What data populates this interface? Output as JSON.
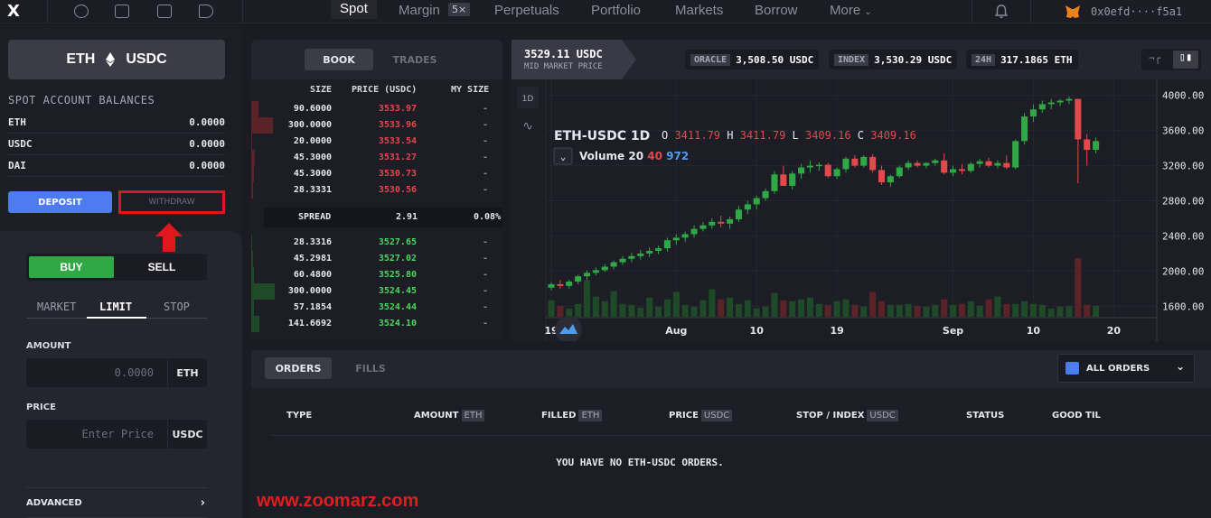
{
  "nav": {
    "logo": "X",
    "menu": [
      "Spot",
      "Margin",
      "Perpetuals",
      "Portfolio",
      "Markets",
      "Borrow",
      "More"
    ],
    "margin_badge": "5×",
    "address": "0x0efd····f5a1"
  },
  "left": {
    "pair": {
      "base": "ETH",
      "quote": "USDC"
    },
    "balances_title": "SPOT ACCOUNT BALANCES",
    "balances": [
      {
        "asset": "ETH",
        "amount": "0.0000"
      },
      {
        "asset": "USDC",
        "amount": "0.0000"
      },
      {
        "asset": "DAI",
        "amount": "0.0000"
      }
    ],
    "deposit_label": "DEPOSIT",
    "withdraw_label": "WITHDRAW",
    "buy_label": "BUY",
    "sell_label": "SELL",
    "order_tabs": [
      "MARKET",
      "LIMIT",
      "STOP"
    ],
    "amount_label": "AMOUNT",
    "amount_value": "0.0000",
    "amount_unit": "ETH",
    "price_label": "PRICE",
    "price_placeholder": "Enter Price",
    "price_unit": "USDC",
    "advanced_label": "ADVANCED"
  },
  "book": {
    "tabs": [
      "BOOK",
      "TRADES"
    ],
    "headers": {
      "size": "SIZE",
      "price": "PRICE (USDC)",
      "my": "MY SIZE"
    },
    "asks": [
      {
        "size": "90.6000",
        "price": "3533.97",
        "my": "-",
        "depth": 0.27
      },
      {
        "size": "300.0000",
        "price": "3533.96",
        "my": "-",
        "depth": 0.8
      },
      {
        "size": "20.0000",
        "price": "3533.54",
        "my": "-",
        "depth": 0.02
      },
      {
        "size": "45.3000",
        "price": "3531.27",
        "my": "-",
        "depth": 0.12
      },
      {
        "size": "45.3000",
        "price": "3530.73",
        "my": "-",
        "depth": 0.09
      },
      {
        "size": "28.3331",
        "price": "3530.56",
        "my": "-",
        "depth": 0.06
      }
    ],
    "spread": {
      "label": "SPREAD",
      "value": "2.91",
      "pct": "0.08%"
    },
    "bids": [
      {
        "size": "28.3316",
        "price": "3527.65",
        "my": "-",
        "depth": 0.04
      },
      {
        "size": "45.2981",
        "price": "3527.02",
        "my": "-",
        "depth": 0.06
      },
      {
        "size": "60.4800",
        "price": "3525.80",
        "my": "-",
        "depth": 0.1
      },
      {
        "size": "300.0000",
        "price": "3524.45",
        "my": "-",
        "depth": 0.85
      },
      {
        "size": "57.1854",
        "price": "3524.44",
        "my": "-",
        "depth": 0.1
      },
      {
        "size": "141.6692",
        "price": "3524.10",
        "my": "-",
        "depth": 0.3
      }
    ]
  },
  "chart_header": {
    "mid_price": "3529.11 USDC",
    "mid_label": "MID MARKET PRICE",
    "oracle_label": "ORACLE",
    "oracle_value": "3,508.50 USDC",
    "index_label": "INDEX",
    "index_value": "3,530.29 USDC",
    "vol_label": "24H",
    "vol_value": "317.1865 ETH"
  },
  "chart_data": {
    "type": "candlestick",
    "symbol": "ETH-USDC",
    "interval": "1D",
    "ohlc_labels": {
      "o": "3411.79",
      "h": "3411.79",
      "l": "3409.16",
      "c": "3409.16"
    },
    "volume_label": "Volume 20",
    "volume_vals": [
      "40",
      "972"
    ],
    "y_ticks": [
      4000,
      3600,
      3200,
      2800,
      2400,
      2000,
      1600
    ],
    "ylim": [
      1500,
      4100
    ],
    "x_ticks": [
      "19",
      "Aug",
      "10",
      "19",
      "Sep",
      "10",
      "20"
    ],
    "candles": [
      [
        1810,
        1870,
        1780,
        1850
      ],
      [
        1850,
        1900,
        1800,
        1830
      ],
      [
        1830,
        1900,
        1800,
        1880
      ],
      [
        1880,
        1960,
        1850,
        1940
      ],
      [
        1940,
        2010,
        1900,
        1980
      ],
      [
        1980,
        2040,
        1950,
        2010
      ],
      [
        2010,
        2080,
        1990,
        2050
      ],
      [
        2050,
        2120,
        2020,
        2100
      ],
      [
        2100,
        2170,
        2070,
        2140
      ],
      [
        2140,
        2210,
        2100,
        2170
      ],
      [
        2170,
        2240,
        2130,
        2200
      ],
      [
        2200,
        2270,
        2160,
        2230
      ],
      [
        2230,
        2290,
        2190,
        2260
      ],
      [
        2260,
        2380,
        2220,
        2350
      ],
      [
        2350,
        2420,
        2300,
        2380
      ],
      [
        2380,
        2450,
        2330,
        2420
      ],
      [
        2420,
        2520,
        2380,
        2480
      ],
      [
        2480,
        2560,
        2450,
        2520
      ],
      [
        2520,
        2600,
        2480,
        2560
      ],
      [
        2560,
        2630,
        2500,
        2540
      ],
      [
        2540,
        2620,
        2480,
        2590
      ],
      [
        2590,
        2740,
        2560,
        2700
      ],
      [
        2700,
        2800,
        2650,
        2760
      ],
      [
        2760,
        2860,
        2700,
        2830
      ],
      [
        2830,
        2940,
        2800,
        2910
      ],
      [
        2910,
        3140,
        2880,
        3100
      ],
      [
        3100,
        3200,
        3000,
        2970
      ],
      [
        2970,
        3140,
        2930,
        3110
      ],
      [
        3110,
        3220,
        3050,
        3180
      ],
      [
        3180,
        3260,
        3120,
        3200
      ],
      [
        3200,
        3240,
        3140,
        3210
      ],
      [
        3210,
        3230,
        3060,
        3080
      ],
      [
        3080,
        3180,
        3050,
        3160
      ],
      [
        3160,
        3300,
        3120,
        3280
      ],
      [
        3280,
        3320,
        3180,
        3200
      ],
      [
        3200,
        3320,
        3180,
        3300
      ],
      [
        3300,
        3330,
        3120,
        3150
      ],
      [
        3150,
        3200,
        2980,
        3010
      ],
      [
        3010,
        3100,
        2960,
        3080
      ],
      [
        3080,
        3200,
        3060,
        3180
      ],
      [
        3180,
        3260,
        3150,
        3230
      ],
      [
        3230,
        3260,
        3180,
        3200
      ],
      [
        3200,
        3240,
        3170,
        3230
      ],
      [
        3230,
        3280,
        3200,
        3260
      ],
      [
        3260,
        3340,
        3100,
        3120
      ],
      [
        3120,
        3200,
        3080,
        3160
      ],
      [
        3160,
        3220,
        3100,
        3140
      ],
      [
        3140,
        3240,
        3120,
        3220
      ],
      [
        3220,
        3280,
        3180,
        3250
      ],
      [
        3250,
        3290,
        3180,
        3200
      ],
      [
        3200,
        3260,
        3170,
        3230
      ],
      [
        3230,
        3320,
        3160,
        3180
      ],
      [
        3180,
        3500,
        3160,
        3480
      ],
      [
        3480,
        3800,
        3440,
        3760
      ],
      [
        3760,
        3900,
        3700,
        3840
      ],
      [
        3840,
        3940,
        3800,
        3900
      ],
      [
        3900,
        3960,
        3840,
        3920
      ],
      [
        3920,
        3960,
        3880,
        3940
      ],
      [
        3940,
        3990,
        3900,
        3960
      ],
      [
        3960,
        3960,
        3000,
        3500
      ],
      [
        3500,
        3560,
        3200,
        3380
      ],
      [
        3380,
        3520,
        3340,
        3480
      ],
      [
        3480,
        3520,
        3400,
        3440
      ],
      [
        3440,
        3460,
        3180,
        3220
      ],
      [
        3220,
        3300,
        3160,
        3300
      ],
      [
        3300,
        3340,
        3200,
        3260
      ],
      [
        3260,
        3420,
        3240,
        3400
      ],
      [
        3400,
        3420,
        3280,
        3320
      ],
      [
        3320,
        3400,
        3200,
        3340
      ],
      [
        3340,
        3560,
        3320,
        3520
      ],
      [
        3520,
        3640,
        3480,
        3600
      ],
      [
        3600,
        3620,
        3380,
        3420
      ],
      [
        3420,
        3430,
        3400,
        3410
      ]
    ],
    "volume": [
      18,
      12,
      9,
      14,
      40,
      22,
      17,
      28,
      14,
      13,
      10,
      21,
      11,
      19,
      27,
      13,
      11,
      18,
      30,
      19,
      21,
      14,
      18,
      9,
      11,
      26,
      18,
      17,
      19,
      21,
      14,
      13,
      17,
      19,
      13,
      11,
      27,
      17,
      13,
      13,
      14,
      12,
      11,
      13,
      19,
      13,
      14,
      17,
      12,
      19,
      22,
      14,
      14,
      17,
      14,
      13,
      9,
      11,
      12,
      64,
      13,
      12,
      9,
      8,
      5,
      7,
      6,
      4,
      7,
      5,
      3,
      4,
      3
    ]
  },
  "orders": {
    "tabs": [
      "ORDERS",
      "FILLS"
    ],
    "filter": "ALL ORDERS",
    "columns": [
      {
        "label": "TYPE",
        "unit": ""
      },
      {
        "label": "AMOUNT",
        "unit": "ETH"
      },
      {
        "label": "FILLED",
        "unit": "ETH"
      },
      {
        "label": "PRICE",
        "unit": "USDC"
      },
      {
        "label": "STOP / INDEX",
        "unit": "USDC"
      },
      {
        "label": "STATUS",
        "unit": ""
      },
      {
        "label": "GOOD TIL",
        "unit": ""
      }
    ],
    "empty_message": "YOU HAVE NO ETH-USDC ORDERS."
  },
  "watermark": "www.zoomarz.com",
  "colors": {
    "buy": "#2fa845",
    "sell": "#e04a4a",
    "accent": "#4c7cf0",
    "highlight": "#e0181e"
  }
}
